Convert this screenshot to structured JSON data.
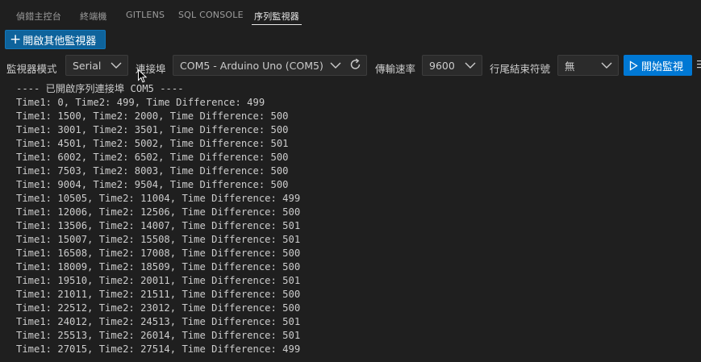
{
  "tabs": [
    {
      "label": "偵錯主控台"
    },
    {
      "label": "終端機"
    },
    {
      "label": "GITLENS"
    },
    {
      "label": "SQL CONSOLE"
    },
    {
      "label": "序列監視器",
      "active": true
    }
  ],
  "open_button": {
    "label": "開啟其他監視器",
    "icon": "plus-icon"
  },
  "toolbar": {
    "monitor_mode_label": "監視器模式",
    "monitor_mode_value": "Serial",
    "port_label": "連接埠",
    "port_value": "COM5 - Arduino Uno (COM5)",
    "baud_label": "傳輸速率",
    "baud_value": "9600",
    "line_ending_label": "行尾結束符號",
    "line_ending_value": "無",
    "start_label": "開始監視"
  },
  "output_lines": [
    "---- 已開啟序列連接埠 COM5 ----",
    "Time1: 0, Time2: 499, Time Difference: 499",
    "Time1: 1500, Time2: 2000, Time Difference: 500",
    "Time1: 3001, Time2: 3501, Time Difference: 500",
    "Time1: 4501, Time2: 5002, Time Difference: 501",
    "Time1: 6002, Time2: 6502, Time Difference: 500",
    "Time1: 7503, Time2: 8003, Time Difference: 500",
    "Time1: 9004, Time2: 9504, Time Difference: 500",
    "Time1: 10505, Time2: 11004, Time Difference: 499",
    "Time1: 12006, Time2: 12506, Time Difference: 500",
    "Time1: 13506, Time2: 14007, Time Difference: 501",
    "Time1: 15007, Time2: 15508, Time Difference: 501",
    "Time1: 16508, Time2: 17008, Time Difference: 500",
    "Time1: 18009, Time2: 18509, Time Difference: 500",
    "Time1: 19510, Time2: 20011, Time Difference: 501",
    "Time1: 21011, Time2: 21511, Time Difference: 500",
    "Time1: 22512, Time2: 23012, Time Difference: 500",
    "Time1: 24012, Time2: 24513, Time Difference: 501",
    "Time1: 25513, Time2: 26014, Time Difference: 501",
    "Time1: 27015, Time2: 27514, Time Difference: 499"
  ],
  "colors": {
    "accent": "#0078d4",
    "background": "#1f1f1f",
    "text": "#cccccc"
  }
}
